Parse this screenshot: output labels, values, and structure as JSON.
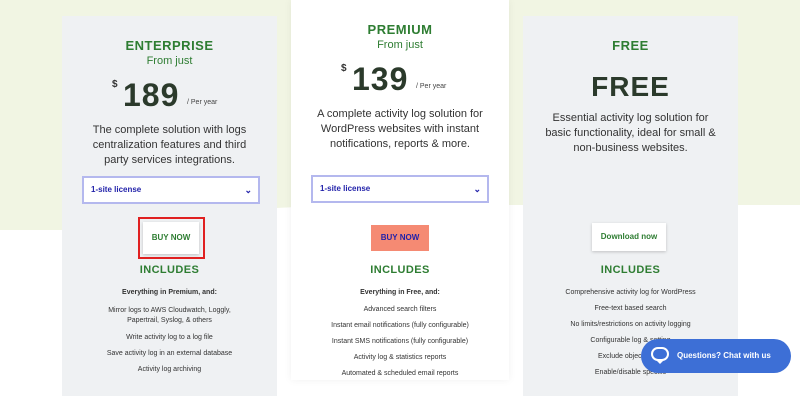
{
  "enterprise": {
    "name": "ENTERPRISE",
    "from": "From just",
    "currency": "$",
    "price": "189",
    "period": "/ Per year",
    "desc": "The complete solution with logs centralization features and third party services integrations.",
    "license": "1-site license",
    "button": "BUY NOW",
    "includes": "INCLUDES",
    "features": [
      "Everything in Premium, and:",
      "Mirror logs to AWS Cloudwatch, Loggly,",
      "Papertrail, Syslog, & others",
      "Write activity log to a log file",
      "Save activity log in an external database",
      "Activity log archiving"
    ]
  },
  "premium": {
    "name": "PREMIUM",
    "from": "From just",
    "currency": "$",
    "price": "139",
    "period": "/ Per year",
    "desc": "A complete activity log solution for WordPress websites with instant notifications, reports & more.",
    "license": "1-site license",
    "button": "BUY NOW",
    "includes": "INCLUDES",
    "features": [
      "Everything in Free, and:",
      "Advanced search filters",
      "Instant email notifications (fully configurable)",
      "Instant SMS notifications (fully configurable)",
      "Activity log & statistics reports",
      "Automated & scheduled email reports"
    ]
  },
  "free": {
    "name": "FREE",
    "big": "FREE",
    "desc": "Essential activity log solution for basic functionality, ideal for small & non-business websites.",
    "button": "Download now",
    "includes": "INCLUDES",
    "features": [
      "Comprehensive activity log for WordPress",
      "Free-text based search",
      "No limits/restrictions on activity logging",
      "Configurable log & setting",
      "Exclude objects from",
      "Enable/disable specific"
    ]
  },
  "chat": {
    "label": "Questions? Chat with us",
    "icon": "chat-bubble-icon",
    "color": "#3d6fd6"
  },
  "colors": {
    "accent_green": "#2e7d32",
    "highlight_red": "#e02020",
    "buy_salmon": "#f58a73"
  }
}
